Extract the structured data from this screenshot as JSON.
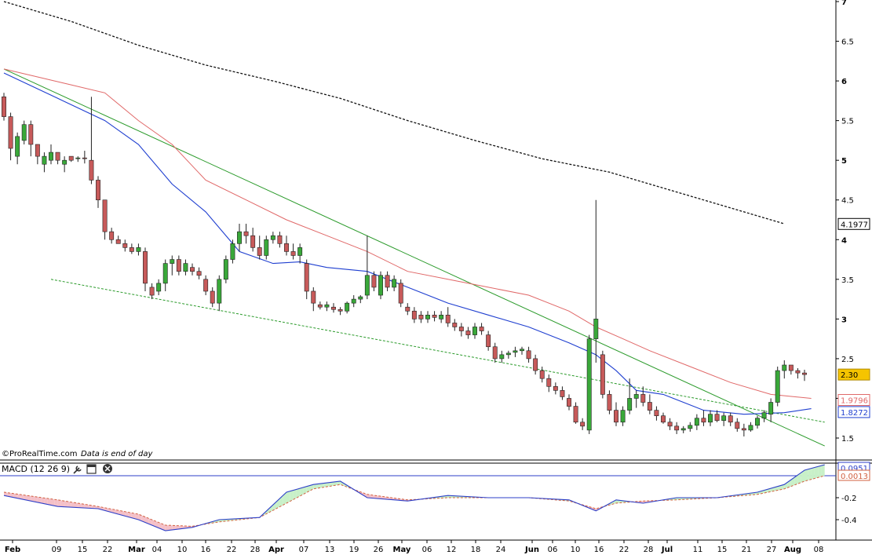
{
  "watermark": {
    "text": "©ProRealTime.com",
    "note": "Data is end of day"
  },
  "panel_macd": {
    "title": "MACD (12 26 9)",
    "icons": [
      "wrench-icon",
      "window-icon",
      "close-icon"
    ]
  },
  "colors": {
    "up": "#39a839",
    "down": "#c75a5a",
    "candle_stroke": "#222222",
    "ma_fast": "#1f3fd0",
    "ma_slow": "#e06868",
    "ma_long": "#111111",
    "trend": "#2a9a2a",
    "support": "#2a9a2a",
    "macd": "#2d3fc8",
    "signal": "#d06040",
    "fill_pos": "#c8f0c8",
    "fill_neg": "#f4c0c8",
    "label_last_bg": "#f5c400",
    "axis": "#000000"
  },
  "chart_data": [
    {
      "type": "candlestick",
      "ylim": [
        1.3,
        7.0
      ],
      "y_ticks": [
        "1.5",
        "2",
        "2.5",
        "3",
        "3.5",
        "4",
        "4.5",
        "5",
        "5.5",
        "6",
        "6.5",
        "7"
      ],
      "x_tick_labels": [
        "Feb",
        "09",
        "15",
        "22",
        "Mar",
        "04",
        "10",
        "16",
        "22",
        "28",
        "Apr",
        "07",
        "13",
        "19",
        "26",
        "May",
        "06",
        "12",
        "18",
        "24",
        "Jun",
        "06",
        "10",
        "16",
        "22",
        "28",
        "Jul",
        "11",
        "15",
        "21",
        "27",
        "Aug",
        "08"
      ],
      "bold_month_labels": [
        "Feb",
        "Mar",
        "Apr",
        "May",
        "Jun",
        "Jul",
        "Aug"
      ],
      "candles": [
        [
          5.8,
          5.85,
          5.5,
          5.55
        ],
        [
          5.55,
          5.6,
          5.0,
          5.15
        ],
        [
          5.05,
          5.35,
          4.95,
          5.3
        ],
        [
          5.25,
          5.5,
          5.2,
          5.45
        ],
        [
          5.45,
          5.5,
          5.05,
          5.2
        ],
        [
          5.2,
          5.2,
          4.95,
          5.05
        ],
        [
          4.95,
          5.1,
          4.85,
          5.05
        ],
        [
          5.0,
          5.2,
          4.95,
          5.1
        ],
        [
          5.1,
          5.1,
          4.95,
          5.0
        ],
        [
          4.95,
          5.05,
          4.85,
          5.0
        ],
        [
          5.05,
          5.05,
          4.98,
          5.0
        ],
        [
          5.02,
          5.05,
          4.98,
          5.03
        ],
        [
          5.03,
          5.12,
          4.96,
          5.02
        ],
        [
          5.0,
          5.8,
          4.7,
          4.75
        ],
        [
          4.75,
          4.8,
          4.4,
          4.5
        ],
        [
          4.5,
          4.5,
          4.0,
          4.1
        ],
        [
          4.1,
          4.15,
          3.95,
          4.0
        ],
        [
          4.0,
          4.05,
          3.95,
          3.95
        ],
        [
          3.95,
          4.0,
          3.85,
          3.9
        ],
        [
          3.9,
          3.95,
          3.82,
          3.85
        ],
        [
          3.85,
          3.95,
          3.8,
          3.9
        ],
        [
          3.85,
          3.9,
          3.35,
          3.45
        ],
        [
          3.4,
          3.45,
          3.25,
          3.3
        ],
        [
          3.35,
          3.5,
          3.3,
          3.45
        ],
        [
          3.45,
          3.75,
          3.35,
          3.7
        ],
        [
          3.7,
          3.8,
          3.55,
          3.75
        ],
        [
          3.75,
          3.8,
          3.55,
          3.6
        ],
        [
          3.6,
          3.75,
          3.55,
          3.7
        ],
        [
          3.65,
          3.7,
          3.55,
          3.6
        ],
        [
          3.6,
          3.65,
          3.5,
          3.55
        ],
        [
          3.5,
          3.55,
          3.3,
          3.35
        ],
        [
          3.35,
          3.4,
          3.15,
          3.2
        ],
        [
          3.2,
          3.55,
          3.1,
          3.5
        ],
        [
          3.5,
          3.8,
          3.45,
          3.75
        ],
        [
          3.75,
          4.0,
          3.7,
          3.95
        ],
        [
          3.95,
          4.2,
          3.85,
          4.1
        ],
        [
          4.1,
          4.2,
          3.95,
          4.05
        ],
        [
          4.05,
          4.15,
          3.85,
          3.9
        ],
        [
          3.9,
          4.05,
          3.75,
          3.8
        ],
        [
          3.8,
          4.05,
          3.75,
          4.0
        ],
        [
          4.0,
          4.1,
          3.95,
          4.05
        ],
        [
          4.05,
          4.1,
          3.9,
          3.95
        ],
        [
          3.95,
          4.05,
          3.8,
          3.85
        ],
        [
          3.85,
          3.95,
          3.75,
          3.8
        ],
        [
          3.8,
          3.95,
          3.7,
          3.9
        ],
        [
          3.7,
          3.75,
          3.25,
          3.35
        ],
        [
          3.35,
          3.4,
          3.1,
          3.2
        ],
        [
          3.18,
          3.22,
          3.12,
          3.15
        ],
        [
          3.15,
          3.22,
          3.1,
          3.18
        ],
        [
          3.15,
          3.2,
          3.08,
          3.12
        ],
        [
          3.12,
          3.15,
          3.05,
          3.1
        ],
        [
          3.1,
          3.22,
          3.07,
          3.2
        ],
        [
          3.2,
          3.3,
          3.15,
          3.25
        ],
        [
          3.25,
          3.3,
          3.2,
          3.28
        ],
        [
          3.3,
          4.05,
          3.25,
          3.55
        ],
        [
          3.55,
          3.6,
          3.35,
          3.4
        ],
        [
          3.3,
          3.6,
          3.25,
          3.55
        ],
        [
          3.55,
          3.6,
          3.35,
          3.4
        ],
        [
          3.4,
          3.55,
          3.35,
          3.5
        ],
        [
          3.45,
          3.5,
          3.15,
          3.2
        ],
        [
          3.15,
          3.2,
          3.05,
          3.1
        ],
        [
          3.1,
          3.15,
          2.95,
          3.0
        ],
        [
          3.05,
          3.1,
          2.95,
          3.0
        ],
        [
          3.0,
          3.1,
          2.95,
          3.05
        ],
        [
          3.05,
          3.1,
          2.97,
          3.02
        ],
        [
          3.0,
          3.1,
          2.95,
          3.05
        ],
        [
          3.05,
          3.15,
          2.9,
          2.95
        ],
        [
          2.95,
          3.0,
          2.85,
          2.9
        ],
        [
          2.9,
          2.95,
          2.78,
          2.85
        ],
        [
          2.85,
          2.9,
          2.75,
          2.8
        ],
        [
          2.8,
          2.95,
          2.75,
          2.9
        ],
        [
          2.9,
          2.95,
          2.8,
          2.85
        ],
        [
          2.8,
          2.85,
          2.6,
          2.65
        ],
        [
          2.65,
          2.7,
          2.45,
          2.5
        ],
        [
          2.5,
          2.6,
          2.45,
          2.55
        ],
        [
          2.55,
          2.6,
          2.5,
          2.57
        ],
        [
          2.58,
          2.65,
          2.52,
          2.6
        ],
        [
          2.6,
          2.65,
          2.55,
          2.62
        ],
        [
          2.6,
          2.65,
          2.45,
          2.5
        ],
        [
          2.5,
          2.55,
          2.3,
          2.35
        ],
        [
          2.35,
          2.4,
          2.2,
          2.25
        ],
        [
          2.25,
          2.3,
          2.08,
          2.15
        ],
        [
          2.15,
          2.2,
          2.05,
          2.1
        ],
        [
          2.1,
          2.15,
          1.98,
          2.02
        ],
        [
          2.0,
          2.05,
          1.85,
          1.9
        ],
        [
          1.9,
          1.95,
          1.68,
          1.7
        ],
        [
          1.7,
          1.75,
          1.6,
          1.65
        ],
        [
          1.6,
          2.8,
          1.55,
          2.75
        ],
        [
          2.75,
          4.5,
          2.45,
          3.0
        ],
        [
          2.55,
          2.6,
          2.0,
          2.05
        ],
        [
          2.05,
          2.1,
          1.8,
          1.85
        ],
        [
          1.85,
          1.95,
          1.65,
          1.7
        ],
        [
          1.7,
          1.9,
          1.65,
          1.85
        ],
        [
          1.85,
          2.25,
          1.8,
          2.0
        ],
        [
          2.0,
          2.1,
          1.88,
          2.05
        ],
        [
          2.05,
          2.15,
          1.9,
          1.95
        ],
        [
          1.95,
          2.05,
          1.8,
          1.85
        ],
        [
          1.85,
          1.9,
          1.72,
          1.78
        ],
        [
          1.78,
          1.82,
          1.68,
          1.7
        ],
        [
          1.7,
          1.75,
          1.6,
          1.65
        ],
        [
          1.65,
          1.7,
          1.55,
          1.6
        ],
        [
          1.6,
          1.65,
          1.56,
          1.62
        ],
        [
          1.62,
          1.7,
          1.58,
          1.66
        ],
        [
          1.66,
          1.8,
          1.6,
          1.75
        ],
        [
          1.75,
          1.85,
          1.65,
          1.7
        ],
        [
          1.7,
          1.85,
          1.65,
          1.8
        ],
        [
          1.8,
          1.85,
          1.7,
          1.72
        ],
        [
          1.72,
          1.82,
          1.65,
          1.78
        ],
        [
          1.78,
          1.82,
          1.65,
          1.7
        ],
        [
          1.7,
          1.75,
          1.58,
          1.62
        ],
        [
          1.62,
          1.68,
          1.52,
          1.6
        ],
        [
          1.6,
          1.7,
          1.58,
          1.66
        ],
        [
          1.66,
          1.78,
          1.62,
          1.75
        ],
        [
          1.75,
          1.85,
          1.7,
          1.82
        ],
        [
          1.8,
          2.0,
          1.7,
          1.95
        ],
        [
          1.95,
          2.4,
          1.9,
          2.35
        ],
        [
          2.35,
          2.48,
          2.25,
          2.42
        ],
        [
          2.42,
          2.42,
          2.3,
          2.35
        ],
        [
          2.35,
          2.38,
          2.25,
          2.32
        ],
        [
          2.32,
          2.36,
          2.22,
          2.3
        ]
      ],
      "ma_fast_line": [
        [
          0,
          6.1
        ],
        [
          8,
          5.78
        ],
        [
          15,
          5.5
        ],
        [
          20,
          5.2
        ],
        [
          25,
          4.7
        ],
        [
          30,
          4.35
        ],
        [
          35,
          3.85
        ],
        [
          40,
          3.7
        ],
        [
          44,
          3.72
        ],
        [
          48,
          3.65
        ],
        [
          54,
          3.6
        ],
        [
          60,
          3.4
        ],
        [
          66,
          3.2
        ],
        [
          72,
          3.05
        ],
        [
          78,
          2.9
        ],
        [
          84,
          2.7
        ],
        [
          88,
          2.55
        ],
        [
          91,
          2.35
        ],
        [
          94,
          2.1
        ],
        [
          98,
          2.05
        ],
        [
          104,
          1.85
        ],
        [
          110,
          1.8
        ],
        [
          116,
          1.82
        ],
        [
          120,
          1.87
        ]
      ],
      "ma_slow_line": [
        [
          0,
          6.15
        ],
        [
          10,
          5.95
        ],
        [
          15,
          5.85
        ],
        [
          20,
          5.5
        ],
        [
          25,
          5.2
        ],
        [
          30,
          4.75
        ],
        [
          36,
          4.5
        ],
        [
          42,
          4.25
        ],
        [
          48,
          4.05
        ],
        [
          54,
          3.85
        ],
        [
          60,
          3.6
        ],
        [
          66,
          3.5
        ],
        [
          72,
          3.4
        ],
        [
          78,
          3.3
        ],
        [
          84,
          3.1
        ],
        [
          88,
          2.9
        ],
        [
          92,
          2.75
        ],
        [
          96,
          2.6
        ],
        [
          102,
          2.4
        ],
        [
          108,
          2.2
        ],
        [
          114,
          2.05
        ],
        [
          120,
          2.0
        ]
      ],
      "ma_long_line": [
        [
          0,
          7.0
        ],
        [
          10,
          6.75
        ],
        [
          20,
          6.45
        ],
        [
          30,
          6.2
        ],
        [
          40,
          6.0
        ],
        [
          50,
          5.78
        ],
        [
          60,
          5.5
        ],
        [
          70,
          5.25
        ],
        [
          80,
          5.02
        ],
        [
          90,
          4.85
        ],
        [
          100,
          4.6
        ],
        [
          110,
          4.35
        ],
        [
          116,
          4.2
        ]
      ],
      "trend_line": [
        [
          0,
          6.15
        ],
        [
          122,
          1.4
        ]
      ],
      "support_line": [
        [
          7,
          3.5
        ],
        [
          122,
          1.7
        ]
      ],
      "value_labels": {
        "ma_long": "4.1977",
        "last": "2.30",
        "ma_slow": "1.9796",
        "ma_fast": "1.8272"
      }
    },
    {
      "type": "macd",
      "ylim": [
        -0.55,
        0.18
      ],
      "y_ticks": [
        "-0.4",
        "-0.2"
      ],
      "zero_level": 0.0,
      "macd_line": [
        [
          0,
          -0.18
        ],
        [
          8,
          -0.28
        ],
        [
          14,
          -0.3
        ],
        [
          20,
          -0.4
        ],
        [
          24,
          -0.5
        ],
        [
          28,
          -0.47
        ],
        [
          32,
          -0.4
        ],
        [
          38,
          -0.38
        ],
        [
          42,
          -0.15
        ],
        [
          46,
          -0.08
        ],
        [
          50,
          -0.05
        ],
        [
          54,
          -0.2
        ],
        [
          60,
          -0.23
        ],
        [
          66,
          -0.18
        ],
        [
          72,
          -0.2
        ],
        [
          78,
          -0.2
        ],
        [
          84,
          -0.22
        ],
        [
          88,
          -0.32
        ],
        [
          91,
          -0.22
        ],
        [
          95,
          -0.25
        ],
        [
          100,
          -0.2
        ],
        [
          106,
          -0.2
        ],
        [
          112,
          -0.15
        ],
        [
          116,
          -0.08
        ],
        [
          119,
          0.05
        ],
        [
          122,
          0.1
        ]
      ],
      "signal_line": [
        [
          0,
          -0.15
        ],
        [
          8,
          -0.22
        ],
        [
          14,
          -0.28
        ],
        [
          20,
          -0.35
        ],
        [
          24,
          -0.45
        ],
        [
          28,
          -0.46
        ],
        [
          32,
          -0.42
        ],
        [
          38,
          -0.38
        ],
        [
          42,
          -0.25
        ],
        [
          46,
          -0.12
        ],
        [
          50,
          -0.08
        ],
        [
          54,
          -0.17
        ],
        [
          60,
          -0.22
        ],
        [
          66,
          -0.2
        ],
        [
          72,
          -0.2
        ],
        [
          78,
          -0.2
        ],
        [
          84,
          -0.23
        ],
        [
          88,
          -0.3
        ],
        [
          91,
          -0.25
        ],
        [
          95,
          -0.23
        ],
        [
          100,
          -0.22
        ],
        [
          106,
          -0.2
        ],
        [
          112,
          -0.17
        ],
        [
          116,
          -0.12
        ],
        [
          119,
          -0.05
        ],
        [
          122,
          0.0
        ]
      ],
      "value_labels": {
        "macd": "0.0951",
        "signal": "0.0013"
      }
    }
  ]
}
